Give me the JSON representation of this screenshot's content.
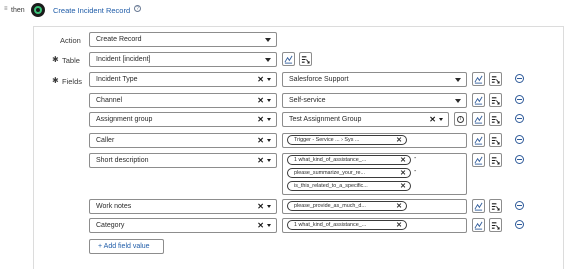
{
  "header": {
    "dot": "≡",
    "then": "then",
    "title": "Create Incident Record",
    "help_icon": "?"
  },
  "action": {
    "label": "Action",
    "value": "Create Record"
  },
  "table": {
    "label": "Table",
    "value": "Incident [incident]"
  },
  "fields_label": "Fields",
  "rows": [
    {
      "field": "Incident Type",
      "value": "Salesforce Support"
    },
    {
      "field": "Channel",
      "value": "Self-service"
    },
    {
      "field": "Assignment group",
      "value": "Test Assignment Group"
    },
    {
      "field": "Caller",
      "pill": "Trigger - Service ... › Sys ..."
    },
    {
      "field": "Short description",
      "pills": [
        "1  what_kind_of_assistance_...",
        "please_summarize_your_re...",
        "is_this_related_to_a_specific..."
      ],
      "sep": "-"
    },
    {
      "field": "Work notes",
      "pill": "please_provide_as_much_d..."
    },
    {
      "field": "Category",
      "pill": "1  what_kind_of_assistance_..."
    }
  ],
  "add_field": "+ Add field value",
  "icons": {
    "clear": "✕",
    "info": "i",
    "required": "✱"
  }
}
